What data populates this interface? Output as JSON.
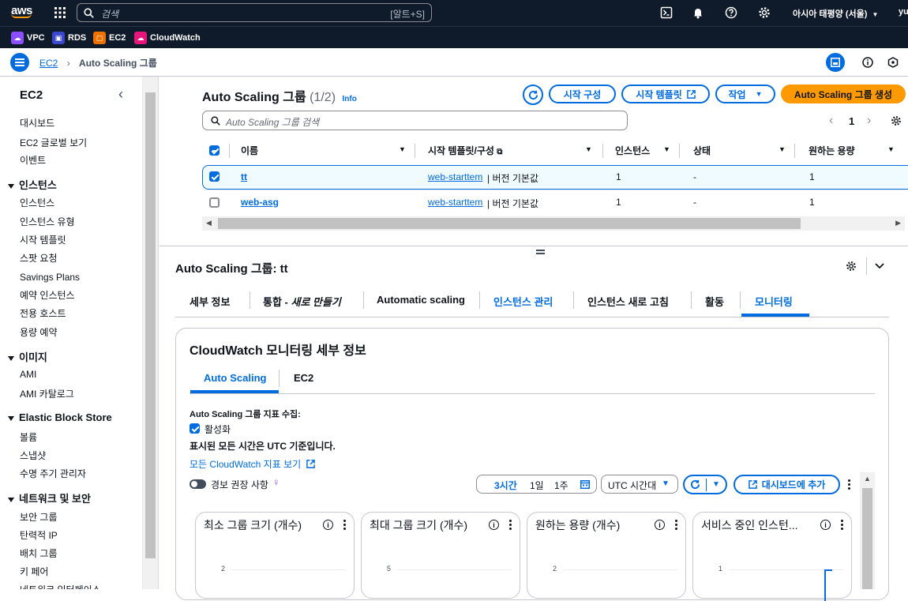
{
  "topbar": {
    "logo": "aws",
    "search_placeholder": "검색",
    "search_shortcut": "[알트+S]",
    "region": "아시아 태평양 (서울)",
    "user": "yu"
  },
  "favorites": [
    {
      "label": "VPC",
      "color": "#8c4fff"
    },
    {
      "label": "RDS",
      "color": "#3b48cc"
    },
    {
      "label": "EC2",
      "color": "#ed7100"
    },
    {
      "label": "CloudWatch",
      "color": "#e7157b"
    }
  ],
  "breadcrumb": {
    "root": "EC2",
    "current": "Auto Scaling 그룹"
  },
  "sidebar": {
    "title": "EC2",
    "top_items": [
      "대시보드",
      "EC2 글로벌 보기",
      "이벤트"
    ],
    "sections": [
      {
        "title": "인스턴스",
        "items": [
          "인스턴스",
          "인스턴스 유형",
          "시작 템플릿",
          "스팟 요청",
          "Savings Plans",
          "예약 인스턴스",
          "전용 호스트",
          "용량 예약"
        ]
      },
      {
        "title": "이미지",
        "items": [
          "AMI",
          "AMI 카탈로그"
        ]
      },
      {
        "title": "Elastic Block Store",
        "items": [
          "볼륨",
          "스냅샷",
          "수명 주기 관리자"
        ]
      },
      {
        "title": "네트워크 및 보안",
        "items": [
          "보안 그룹",
          "탄력적 IP",
          "배치 그룹",
          "키 페어",
          "네트워크 인터페이스"
        ]
      }
    ]
  },
  "asg": {
    "title": "Auto Scaling 그룹",
    "count": "(1/2)",
    "info": "Info",
    "buttons": {
      "launch_config": "시작 구성",
      "launch_template": "시작 템플릿",
      "actions": "작업",
      "create": "Auto Scaling 그룹 생성"
    },
    "search_placeholder": "Auto Scaling 그룹 검색",
    "page": "1",
    "columns": [
      "이름",
      "시작 템플릿/구성",
      "인스턴스",
      "상태",
      "원하는 용량"
    ],
    "rows": [
      {
        "name": "tt",
        "template": "web-starttem",
        "version": "| 버전 기본값",
        "instances": "1",
        "status": "-",
        "desired": "1",
        "selected": true
      },
      {
        "name": "web-asg",
        "template": "web-starttem",
        "version": "| 버전 기본값",
        "instances": "1",
        "status": "-",
        "desired": "1",
        "selected": false
      }
    ]
  },
  "detail": {
    "title": "Auto Scaling 그룹: tt",
    "tabs": [
      "세부 정보",
      "통합 - ",
      "새로 만들기",
      "Automatic scaling",
      "인스턴스 관리",
      "인스턴스 새로 고침",
      "활동",
      "모니터링"
    ],
    "panel_title": "CloudWatch 모니터링 세부 정보",
    "subtabs": [
      "Auto Scaling",
      "EC2"
    ],
    "metrics_label": "Auto Scaling 그룹 지표 수집:",
    "enabled": "활성화",
    "utc_note": "표시된 모든 시간은 UTC 기준입니다.",
    "all_metrics_link": "모든 CloudWatch 지표 보기",
    "alarm_toggle": "경보 권장 사항",
    "time_ranges": [
      "3시간",
      "1일",
      "1주"
    ],
    "timezone": "UTC 시간대",
    "add_dashboard": "대시보드에 추가",
    "cards": [
      {
        "title": "최소 그룹 크기 (개수)",
        "ytick": "2"
      },
      {
        "title": "최대 그룹 크기 (개수)",
        "ytick": "5"
      },
      {
        "title": "원하는 용량 (개수)",
        "ytick": "2"
      },
      {
        "title": "서비스 중인 인스턴...",
        "ytick": "1"
      }
    ]
  },
  "colors": {
    "accent": "#006ce0",
    "primary": "#ff9900",
    "nav": "#0f1b2a"
  }
}
